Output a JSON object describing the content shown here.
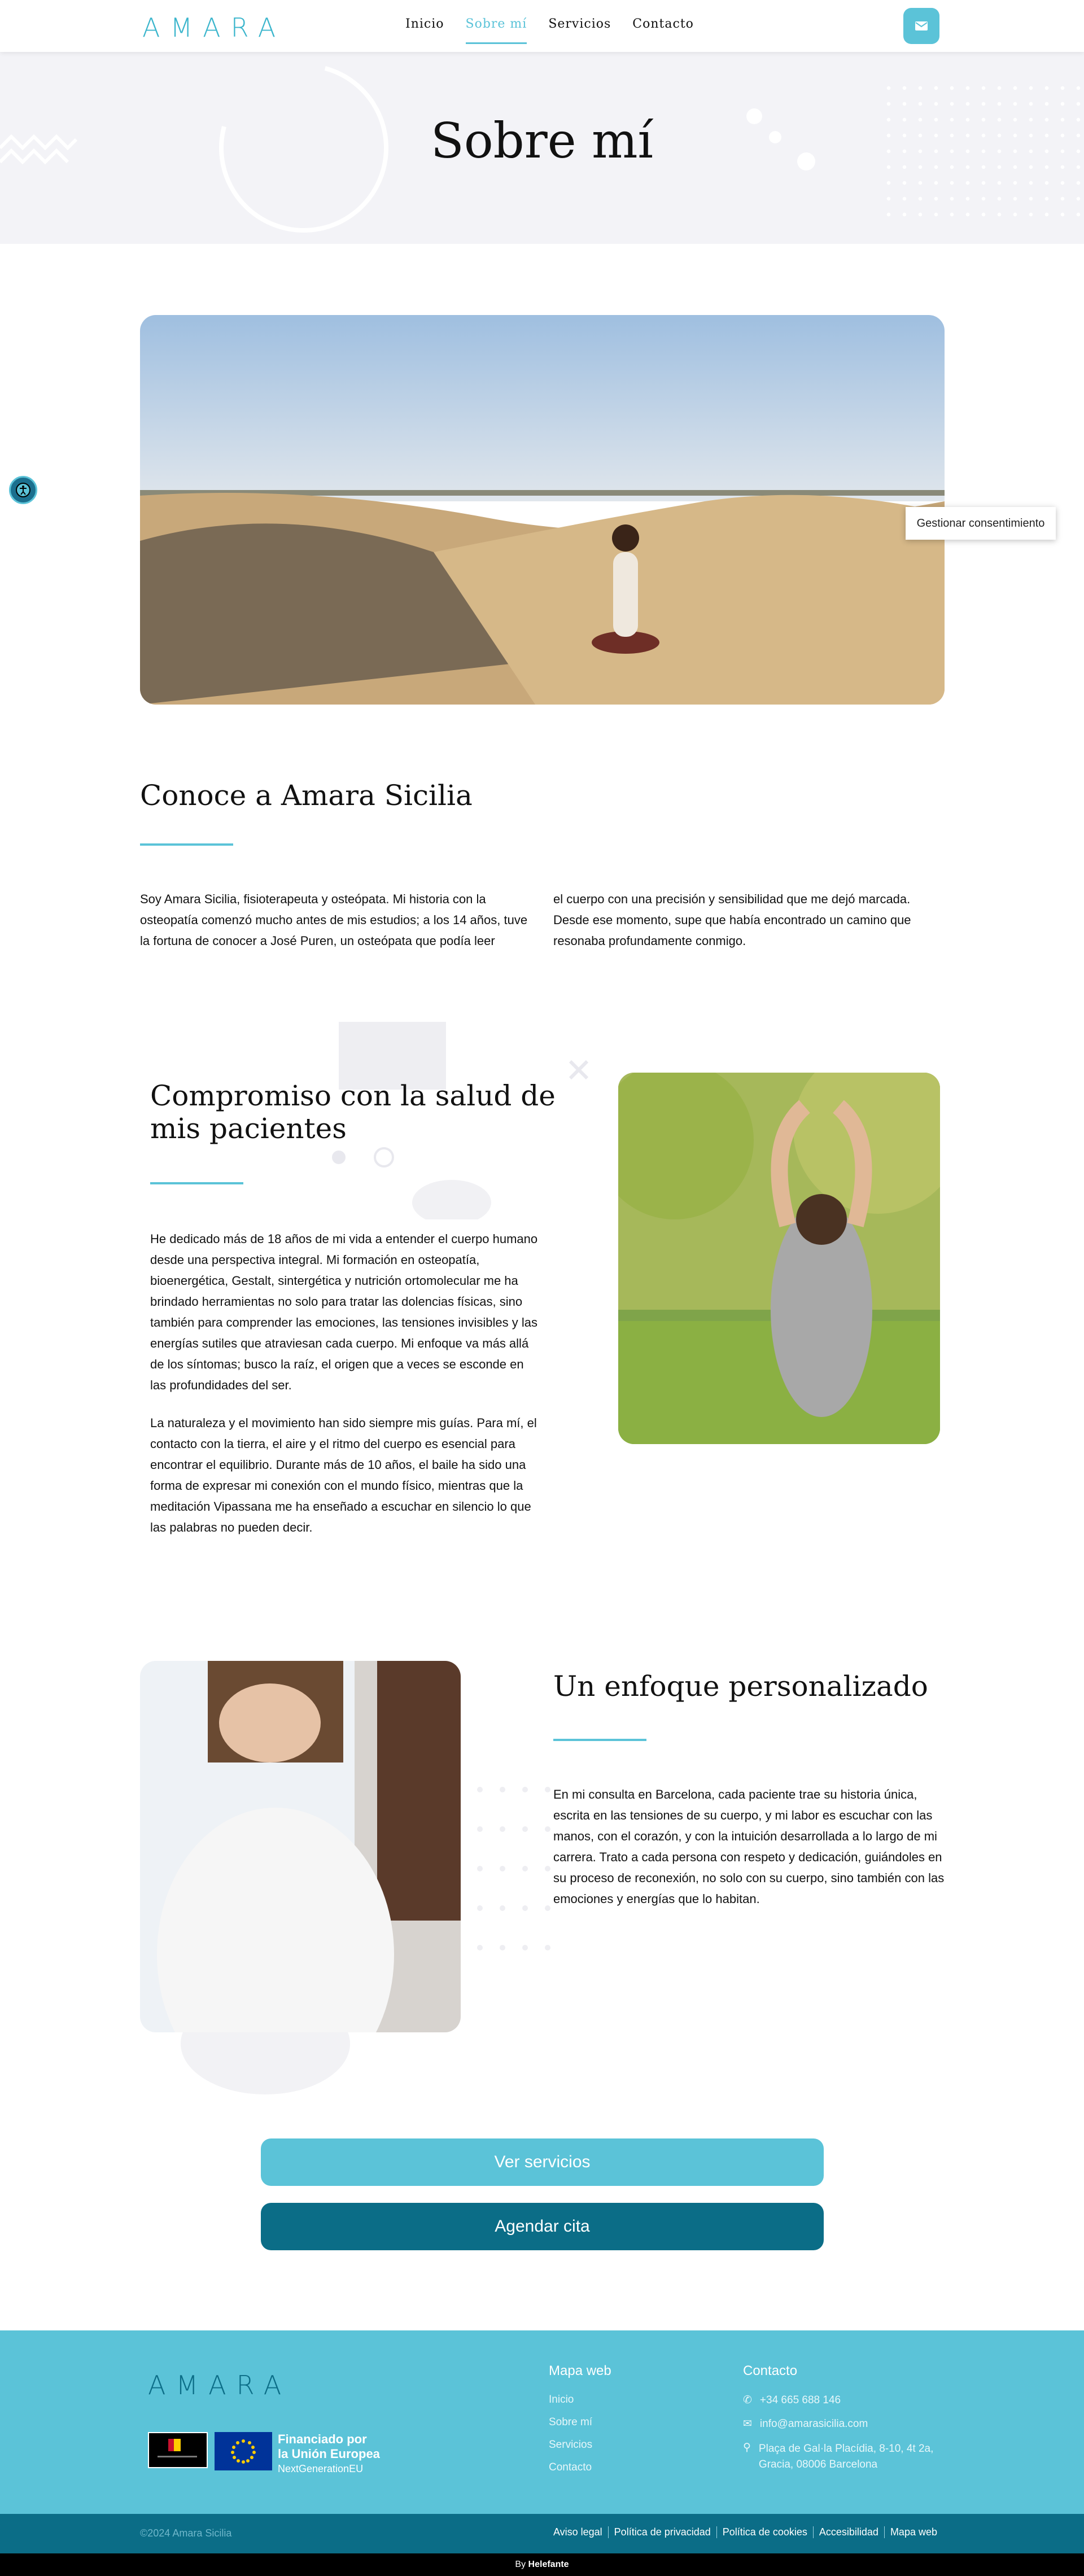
{
  "header": {
    "logo": "AMARA",
    "nav": [
      "Inicio",
      "Sobre mí",
      "Servicios",
      "Contacto"
    ],
    "active_nav": "Sobre mí"
  },
  "hero": {
    "title": "Sobre mí"
  },
  "consent": {
    "label": "Gestionar consentimiento"
  },
  "section_conoce": {
    "title": "Conoce a Amara Sicilia",
    "col1": "Soy Amara Sicilia, fisioterapeuta y osteópata. Mi historia con la osteopatía comenzó mucho antes de mis estudios; a los 14 años, tuve la fortuna de conocer a José Puren, un osteópata que podía leer",
    "col2": "el cuerpo con una precisión y sensibilidad que me dejó marcada. Desde ese momento, supe que había encontrado un camino que resonaba profundamente conmigo."
  },
  "section_compromiso": {
    "title_line1": "Compromiso con la salud de",
    "title_line2": "mis pacientes",
    "p1": "He dedicado más de 18 años de mi vida a entender el cuerpo humano desde una perspectiva integral. Mi formación en osteopatía, bioenergética, Gestalt, sintergética y nutrición ortomolecular me ha brindado herramientas no solo para tratar las dolencias físicas, sino también para comprender las emociones, las tensiones invisibles y las energías sutiles que atraviesan cada cuerpo. Mi enfoque va más allá de los síntomas; busco la raíz, el origen que a veces se esconde en las profundidades del ser.",
    "p2": "La naturaleza y el movimiento han sido siempre mis guías. Para mí, el contacto con la tierra, el aire y el ritmo del cuerpo es esencial para encontrar el equilibrio. Durante más de 10 años, el baile ha sido una forma de expresar mi conexión con el mundo físico, mientras que la meditación Vipassana me ha enseñado a escuchar en silencio lo que las palabras no pueden decir."
  },
  "section_enfoque": {
    "title": "Un enfoque personalizado",
    "p1": "En mi consulta en Barcelona, cada paciente trae su historia única, escrita en las tensiones de su cuerpo, y mi labor es escuchar con las manos, con el corazón, y con la intuición desarrollada a lo largo de mi carrera. Trato a cada persona con respeto y dedicación, guiándoles en su proceso de reconexión, no solo con su cuerpo, sino también con las emociones y energías que lo habitan."
  },
  "buttons": {
    "services": "Ver servicios",
    "appointment": "Agendar cita"
  },
  "footer": {
    "logo": "AMARA",
    "funding_line1": "Financiado por",
    "funding_line2": "la Unión Europea",
    "funding_line3": "NextGenerationEU",
    "map_title": "Mapa web",
    "map_links": [
      "Inicio",
      "Sobre mí",
      "Servicios",
      "Contacto"
    ],
    "contact_title": "Contacto",
    "phone": "+34 665 688 146",
    "email": "info@amarasicilia.com",
    "address_line1": "Plaça de Gal·la Placídia, 8-10, 4t 2a,",
    "address_line2": "Gracia, 08006 Barcelona",
    "copyright": "©2024 Amara Sicilia",
    "legal_links": [
      "Aviso legal",
      "Política de privacidad",
      "Política de cookies",
      "Accesibilidad",
      "Mapa web"
    ],
    "by_prefix": "By ",
    "by_name": "Helefante"
  },
  "colors": {
    "accent": "#5bc3d8",
    "dark_teal": "#0b6d87",
    "hero_bg": "#f3f3f7"
  },
  "icons": [
    "mail-icon",
    "accessibility-icon",
    "phone-icon",
    "envelope-icon",
    "location-pin-icon"
  ]
}
